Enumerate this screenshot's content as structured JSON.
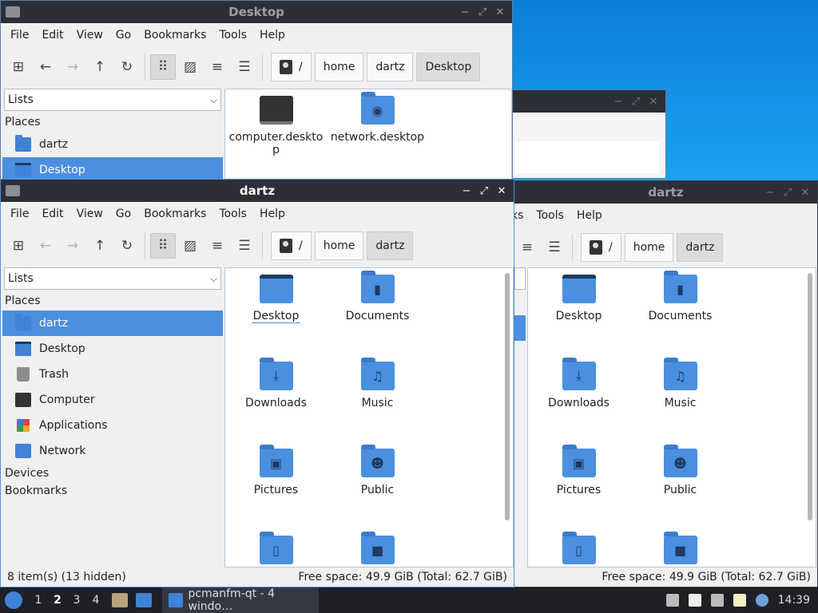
{
  "menu": [
    "File",
    "Edit",
    "View",
    "Go",
    "Bookmarks",
    "Tools",
    "Help"
  ],
  "menu_partial": [
    "ks",
    "Tools",
    "Help"
  ],
  "icons": {
    "new_tab": "new-tab-icon",
    "back": "back-arrow-icon",
    "forward": "forward-arrow-icon",
    "up": "up-arrow-icon",
    "reload": "reload-icon",
    "icon_view": "icon-view-icon",
    "thumb_view": "thumbnail-view-icon",
    "compact_view": "compact-view-icon",
    "detail_view": "detail-list-icon"
  },
  "window_desktop": {
    "title": "Desktop",
    "crumbs": [
      "/",
      "home",
      "dartz",
      "Desktop"
    ],
    "combo": "Lists",
    "places_header": "Places",
    "places": [
      "dartz",
      "Desktop"
    ],
    "files": [
      {
        "label": "computer.deskto p",
        "icon": "computer-icon"
      },
      {
        "label": "network.desktop",
        "icon": "network-folder-icon"
      }
    ]
  },
  "window_dartz": {
    "title": "dartz",
    "crumbs": [
      "/",
      "home",
      "dartz"
    ],
    "combo": "Lists",
    "places_header": "Places",
    "places": [
      "dartz",
      "Desktop",
      "Trash",
      "Computer",
      "Applications",
      "Network"
    ],
    "devices": "Devices",
    "bookmarks": "Bookmarks",
    "files": [
      "Desktop",
      "Documents",
      "Downloads",
      "Music",
      "Pictures",
      "Public",
      "",
      ""
    ],
    "status_left": "8 item(s) (13 hidden)",
    "status_right": "Free space: 49.9 GiB (Total: 62.7 GiB)"
  },
  "window_right": {
    "title": "dartz",
    "crumbs": [
      "/",
      "home",
      "dartz"
    ],
    "files": [
      "Desktop",
      "Documents",
      "Downloads",
      "Music",
      "Pictures",
      "Public",
      "",
      ""
    ],
    "status_right": "Free space: 49.9 GiB (Total: 62.7 GiB)"
  },
  "window_ctrls": {
    "minimize": "−",
    "maximize": "⤢",
    "close": "✕"
  },
  "taskbar": {
    "workspaces": [
      "1",
      "2",
      "3",
      "4"
    ],
    "task_label": "pcmanfm-qt - 4 windo…",
    "clock": "14:39"
  }
}
